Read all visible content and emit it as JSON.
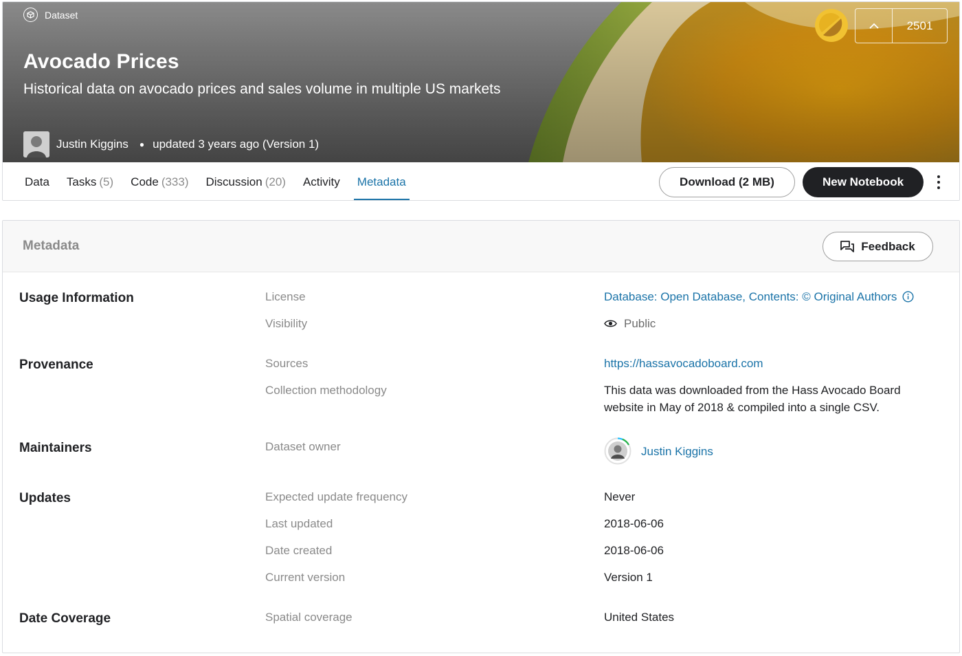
{
  "banner": {
    "type_label": "Dataset",
    "title": "Avocado Prices",
    "subtitle": "Historical data on avocado prices and sales volume in multiple US markets",
    "author": "Justin Kiggins",
    "updated": "updated 3 years ago (Version 1)",
    "vote_count": "2501"
  },
  "tabs": [
    {
      "label": "Data",
      "count": ""
    },
    {
      "label": "Tasks",
      "count": "(5)"
    },
    {
      "label": "Code",
      "count": "(333)"
    },
    {
      "label": "Discussion",
      "count": "(20)"
    },
    {
      "label": "Activity",
      "count": ""
    },
    {
      "label": "Metadata",
      "count": ""
    }
  ],
  "actions": {
    "download": "Download (2 MB)",
    "new_notebook": "New Notebook"
  },
  "metadata": {
    "title": "Metadata",
    "feedback": "Feedback",
    "usage": {
      "title": "Usage Information",
      "license_label": "License",
      "license_value": "Database: Open Database, Contents: © Original Authors",
      "visibility_label": "Visibility",
      "visibility_value": "Public"
    },
    "provenance": {
      "title": "Provenance",
      "sources_label": "Sources",
      "sources_value": "https://hassavocadoboard.com",
      "method_label": "Collection methodology",
      "method_line1": "This data was downloaded from the Hass Avocado Board",
      "method_line2": "website in May of 2018 & compiled into a single CSV."
    },
    "maintainers": {
      "title": "Maintainers",
      "owner_label": "Dataset owner",
      "owner_value": "Justin Kiggins"
    },
    "updates": {
      "title": "Updates",
      "frequency_label": "Expected update frequency",
      "frequency_value": "Never",
      "last_updated_label": "Last updated",
      "last_updated_value": "2018-06-06",
      "created_label": "Date created",
      "created_value": "2018-06-06",
      "version_label": "Current version",
      "version_value": "Version 1"
    },
    "coverage": {
      "title": "Date Coverage",
      "spatial_label": "Spatial coverage",
      "spatial_value": "United States"
    }
  },
  "colors": {
    "link": "#1a73a8",
    "dark_button": "#202124",
    "medal": "#f1c232",
    "avocado_flesh": "#d99a12",
    "avocado_skin": "#5c7a2a"
  }
}
